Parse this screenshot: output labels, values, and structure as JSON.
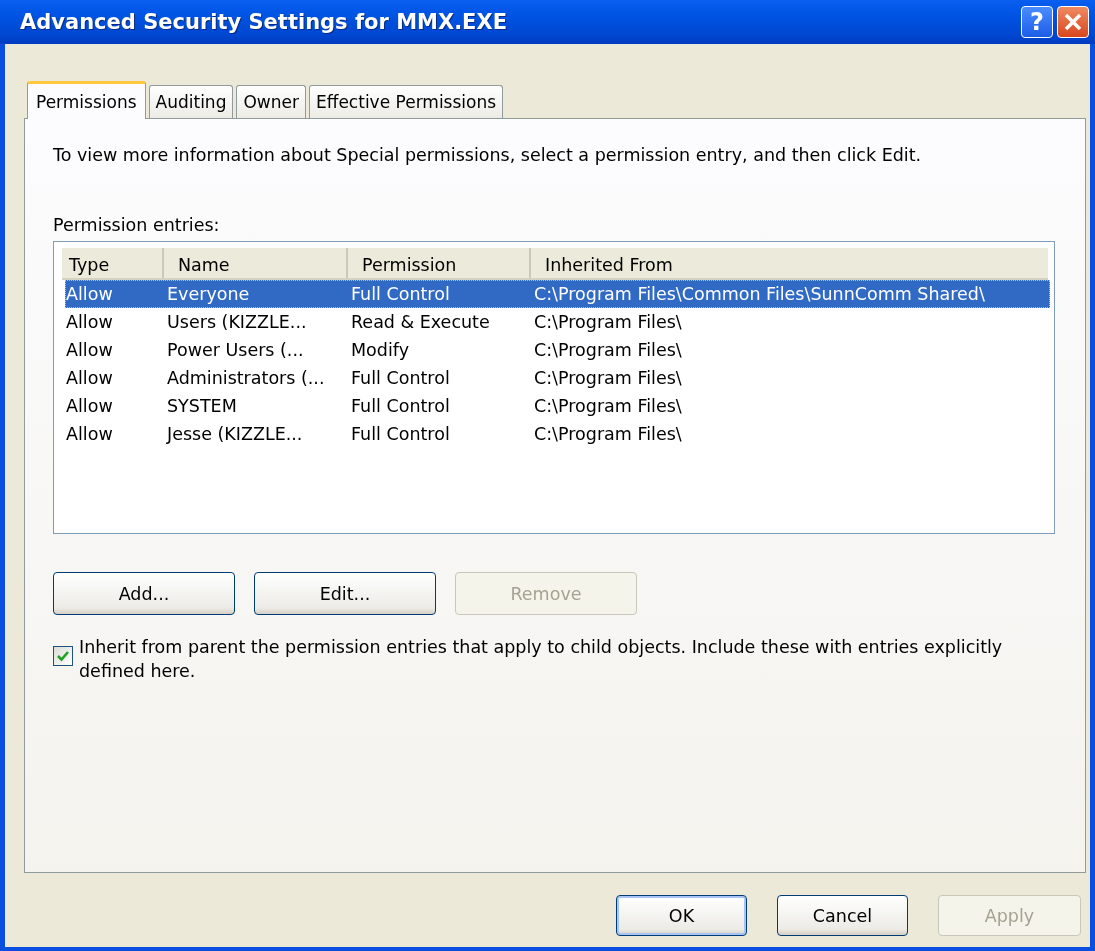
{
  "window": {
    "title": "Advanced Security Settings for MMX.EXE",
    "title_buttons": [
      {
        "kind": "help",
        "label": "?"
      },
      {
        "kind": "close"
      }
    ]
  },
  "tabs": [
    {
      "label": "Permissions",
      "selected": true
    },
    {
      "label": "Auditing",
      "selected": false
    },
    {
      "label": "Owner",
      "selected": false
    },
    {
      "label": "Effective Permissions",
      "selected": false
    }
  ],
  "description": "To view more information about Special permissions, select a permission entry, and then click Edit.",
  "list_label": "Permission entries:",
  "table": {
    "columns": [
      "Type",
      "Name",
      "Permission",
      "Inherited From"
    ],
    "rows": [
      {
        "cells": [
          "Allow",
          "Everyone",
          "Full Control",
          "C:\\Program Files\\Common Files\\SunnComm Shared\\"
        ],
        "selected": true
      },
      {
        "cells": [
          "Allow",
          "Users (KIZZLE...",
          "Read & Execute",
          "C:\\Program Files\\"
        ],
        "selected": false
      },
      {
        "cells": [
          "Allow",
          "Power Users (...",
          "Modify",
          "C:\\Program Files\\"
        ],
        "selected": false
      },
      {
        "cells": [
          "Allow",
          "Administrators (...",
          "Full Control",
          "C:\\Program Files\\"
        ],
        "selected": false
      },
      {
        "cells": [
          "Allow",
          "SYSTEM",
          "Full Control",
          "C:\\Program Files\\"
        ],
        "selected": false
      },
      {
        "cells": [
          "Allow",
          "Jesse (KIZZLE...",
          "Full Control",
          "C:\\Program Files\\"
        ],
        "selected": false
      }
    ]
  },
  "entry_buttons": [
    {
      "label": "Add...",
      "disabled": false
    },
    {
      "label": "Edit...",
      "disabled": false
    },
    {
      "label": "Remove",
      "disabled": true
    }
  ],
  "inherit": {
    "label": "Inherit from parent the permission entries that apply to child objects. Include these with entries explicitly defined here.",
    "checked": true
  },
  "buttons": [
    {
      "label": "OK",
      "disabled": false,
      "default": true
    },
    {
      "label": "Cancel",
      "disabled": false,
      "default": false
    },
    {
      "label": "Apply",
      "disabled": true,
      "default": false
    }
  ]
}
